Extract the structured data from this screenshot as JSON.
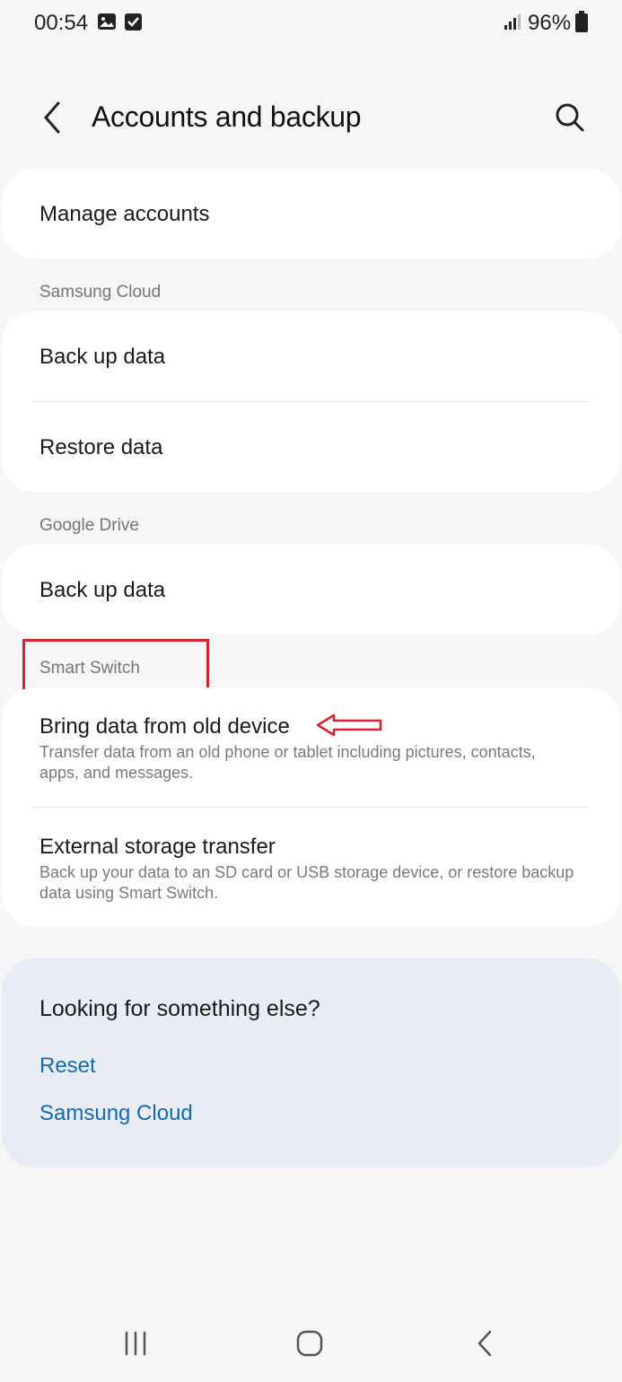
{
  "status_bar": {
    "time": "00:54",
    "battery": "96%",
    "icons": [
      "gallery-icon",
      "checkbox-icon",
      "signal-icon",
      "battery-icon"
    ]
  },
  "header": {
    "title": "Accounts and backup",
    "back_icon": "chevron-left-icon",
    "search_icon": "search-icon"
  },
  "items": {
    "manage_accounts": "Manage accounts",
    "samsung_cloud_section": "Samsung Cloud",
    "samsung_backup": "Back up data",
    "samsung_restore": "Restore data",
    "google_drive_section": "Google Drive",
    "google_backup": "Back up data",
    "smart_switch_section": "Smart Switch",
    "bring_data_title": "Bring data from old device",
    "bring_data_desc": "Transfer data from an old phone or tablet including pictures, contacts, apps, and messages.",
    "external_title": "External storage transfer",
    "external_desc": "Back up your data to an SD card or USB storage device, or restore backup data using Smart Switch."
  },
  "suggestions": {
    "title": "Looking for something else?",
    "links": [
      "Reset",
      "Samsung Cloud"
    ]
  },
  "colors": {
    "background": "#f6f6f6",
    "card": "#ffffff",
    "suggest_card": "#e8edf5",
    "link": "#1369b7",
    "annotation_red": "#d1242f"
  },
  "nav_bar": {
    "icons": [
      "recents-icon",
      "home-icon",
      "back-icon"
    ]
  }
}
